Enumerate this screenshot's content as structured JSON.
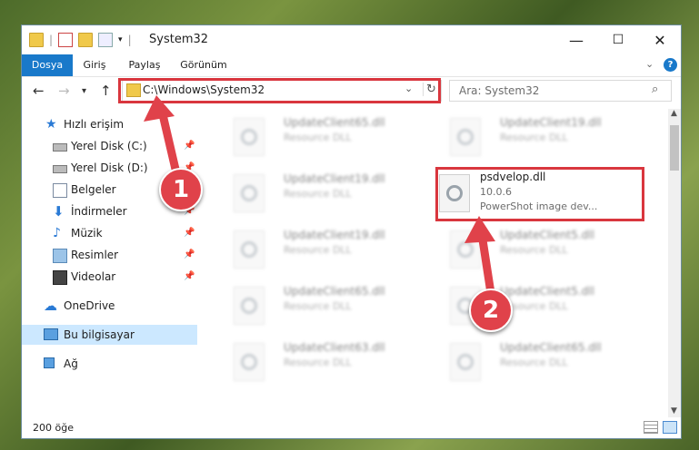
{
  "window": {
    "title": "System32",
    "controls": {
      "minimize": "—",
      "maximize": "☐",
      "close": "✕"
    }
  },
  "ribbon": {
    "tabs": [
      {
        "label": "Dosya",
        "active": true
      },
      {
        "label": "Giriş"
      },
      {
        "label": "Paylaş"
      },
      {
        "label": "Görünüm"
      }
    ]
  },
  "address": {
    "path": "C:\\Windows\\System32",
    "search_placeholder": "Ara: System32"
  },
  "sidebar": {
    "items": [
      {
        "label": "Hızlı erişim",
        "icon": "star-icon",
        "pinned": false
      },
      {
        "label": "Yerel Disk (C:)",
        "icon": "drive-icon",
        "pinned": true
      },
      {
        "label": "Yerel Disk (D:)",
        "icon": "drive-icon",
        "pinned": true
      },
      {
        "label": "Belgeler",
        "icon": "documents-icon",
        "pinned": true
      },
      {
        "label": "İndirmeler",
        "icon": "download-icon",
        "pinned": true
      },
      {
        "label": "Müzik",
        "icon": "music-icon",
        "pinned": true
      },
      {
        "label": "Resimler",
        "icon": "pictures-icon",
        "pinned": true
      },
      {
        "label": "Videolar",
        "icon": "videos-icon",
        "pinned": true
      },
      {
        "label": "OneDrive",
        "icon": "cloud-icon",
        "pinned": false
      },
      {
        "label": "Bu bilgisayar",
        "icon": "computer-icon",
        "pinned": false,
        "selected": true
      },
      {
        "label": "Ağ",
        "icon": "network-icon",
        "pinned": false
      }
    ]
  },
  "files": [
    {
      "name": "UpdateClient65.dll",
      "sub": "Resource DLL"
    },
    {
      "name": "UpdateClient19.dll",
      "sub": "Resource DLL"
    },
    {
      "name": "UpdateClient19.dll",
      "sub": "Resource DLL"
    },
    {
      "name": "psdvelop.dll",
      "sub": "10.0.6",
      "sub2": "PowerShot image dev..."
    },
    {
      "name": "UpdateClient19.dll",
      "sub": "Resource DLL"
    },
    {
      "name": "UpdateClient5.dll",
      "sub": "Resource DLL"
    },
    {
      "name": "UpdateClient65.dll",
      "sub": "Resource DLL"
    },
    {
      "name": "UpdateClient5.dll",
      "sub": "Resource DLL"
    },
    {
      "name": "UpdateClient63.dll",
      "sub": "Resource DLL"
    },
    {
      "name": "UpdateClient65.dll",
      "sub": "Resource DLL"
    }
  ],
  "status": {
    "count": "200 öğe"
  },
  "callouts": {
    "one": "1",
    "two": "2"
  },
  "colors": {
    "accent": "#1979ca",
    "highlight": "#d9363e"
  }
}
